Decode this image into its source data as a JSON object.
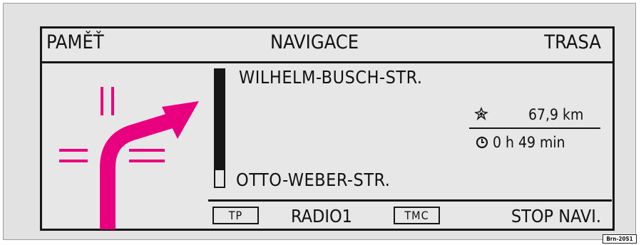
{
  "header": {
    "left_label": "PAMĚŤ",
    "center_title": "NAVIGACE",
    "right_label": "TRASA"
  },
  "route": {
    "current_street": "WILHELM-BUSCH-STR.",
    "next_street": "OTTO-WEBER-STR.",
    "distance_to_turn_fraction": 0.86,
    "turn_direction": "right",
    "arrow_color": "#e8007f"
  },
  "trip": {
    "distance_icon": "destination-flag-icon",
    "distance": "67,9 km",
    "time_icon": "clock-icon",
    "time": "0 h 49 min"
  },
  "footer": {
    "tp_label": "TP",
    "radio_label": "RADIO1",
    "tmc_label": "TMC",
    "stop_label": "STOP NAVI."
  },
  "image_code": "Brn-20S1"
}
